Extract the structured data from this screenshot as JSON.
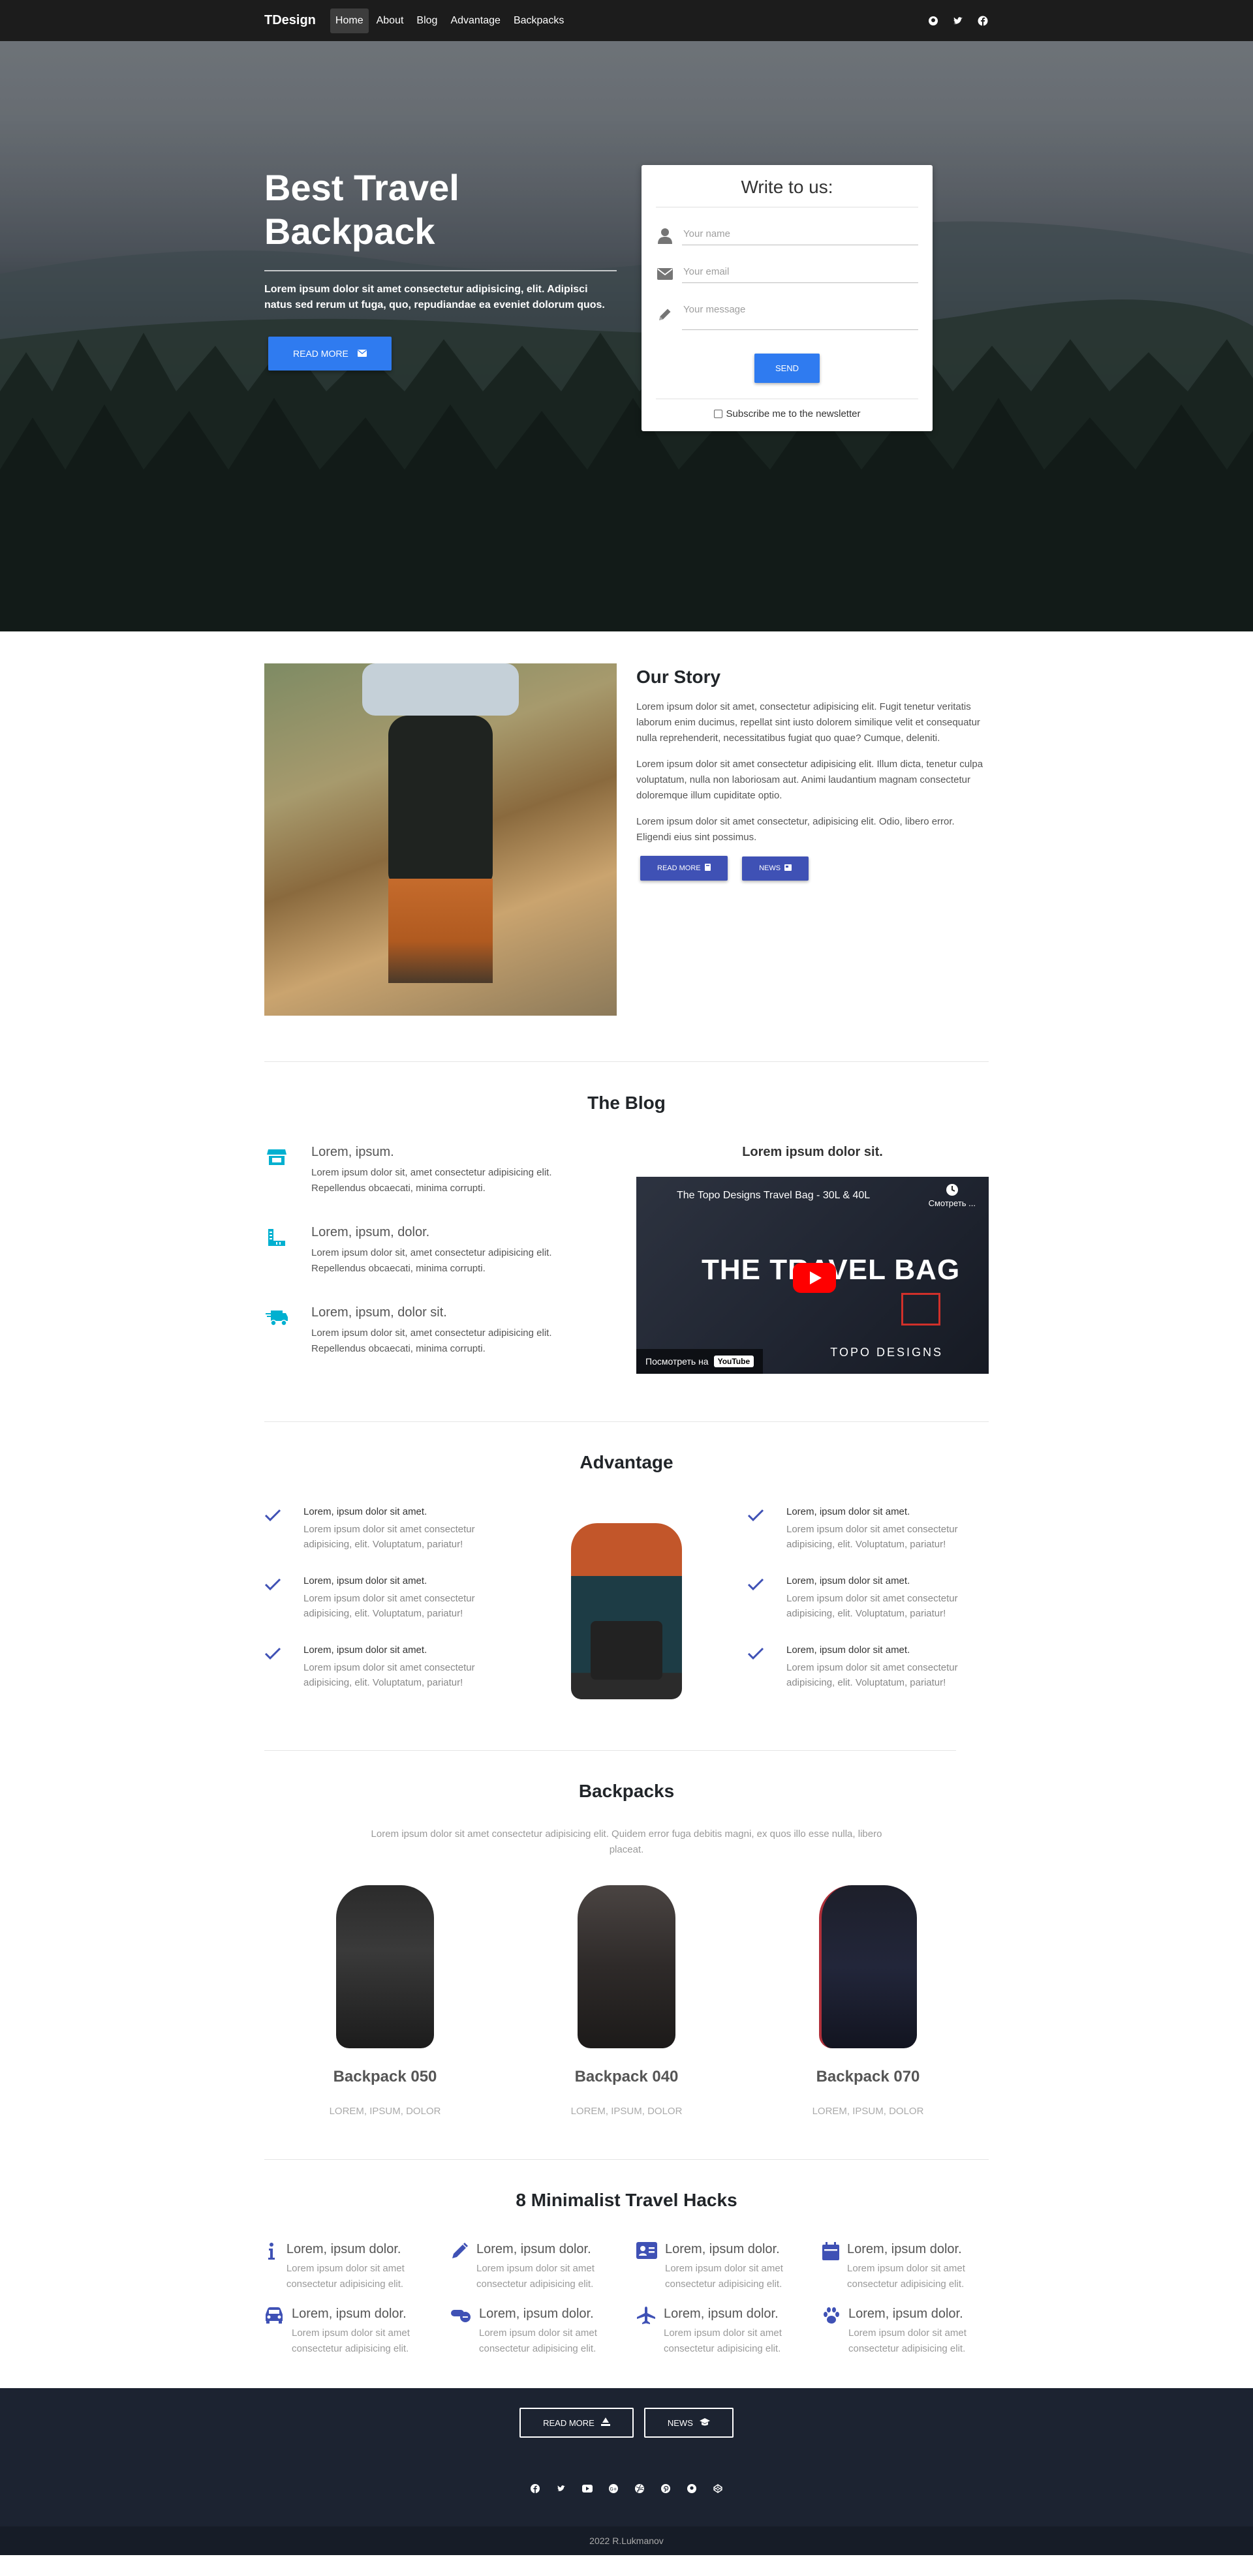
{
  "nav": {
    "brand": "TDesign",
    "links": [
      "Home",
      "About",
      "Blog",
      "Advantage",
      "Backpacks"
    ],
    "social_icons": [
      "github-icon",
      "twitter-icon",
      "facebook-icon"
    ]
  },
  "hero": {
    "title": "Best Travel Backpack",
    "subtitle": "Lorem ipsum dolor sit amet consectetur adipisicing, elit. Adipisci natus sed rerum ut fuga, quo, repudiandae ea eveniet dolorum quos.",
    "button": "Read more",
    "button_icon": "envelope-icon"
  },
  "contact": {
    "title": "Write to us:",
    "name_placeholder": "Your name",
    "email_placeholder": "Your email",
    "message_placeholder": "Your message",
    "send": "Send",
    "subscribe": "Subscribe me to the newsletter"
  },
  "story": {
    "title": "Our Story",
    "paragraphs": [
      "Lorem ipsum dolor sit amet, consectetur adipisicing elit. Fugit tenetur veritatis laborum enim ducimus, repellat sint iusto dolorem similique velit et consequatur nulla reprehenderit, necessitatibus fugiat quo quae? Cumque, deleniti.",
      "Lorem ipsum dolor sit amet consectetur adipisicing elit. Illum dicta, tenetur culpa voluptatum, nulla non laboriosam aut. Animi laudantium magnam consectetur doloremque illum cupiditate optio.",
      "Lorem ipsum dolor sit amet consectetur, adipisicing elit. Odio, libero error. Eligendi eius sint possimus."
    ],
    "buttons": [
      "Read more",
      "News"
    ]
  },
  "blog": {
    "title": "The Blog",
    "items": [
      {
        "icon": "store-icon",
        "title": "Lorem, ipsum.",
        "text": "Lorem ipsum dolor sit, amet consectetur adipisicing elit. Repellendus obcaecati, minima corrupti."
      },
      {
        "icon": "ruler-icon",
        "title": "Lorem, ipsum, dolor.",
        "text": "Lorem ipsum dolor sit, amet consectetur adipisicing elit. Repellendus obcaecati, minima corrupti."
      },
      {
        "icon": "truck-icon",
        "title": "Lorem, ipsum, dolor sit.",
        "text": "Lorem ipsum dolor sit, amet consectetur adipisicing elit. Repellendus obcaecati, minima corrupti."
      }
    ],
    "video_caption": "Lorem ipsum dolor sit.",
    "video": {
      "title": "The Topo Designs Travel Bag - 30L & 40L",
      "watch_later": "Смотреть ...",
      "big_text": "THE TRAVEL BAG",
      "watch_on": "Посмотреть на",
      "youtube": "YouTube",
      "brand": "TOPO DESIGNS"
    }
  },
  "advantage": {
    "title": "Advantage",
    "items": [
      {
        "title": "Lorem, ipsum dolor sit amet.",
        "text": "Lorem ipsum dolor sit amet consectetur adipisicing, elit. Voluptatum, pariatur!"
      },
      {
        "title": "Lorem, ipsum dolor sit amet.",
        "text": "Lorem ipsum dolor sit amet consectetur adipisicing, elit. Voluptatum, pariatur!"
      },
      {
        "title": "Lorem, ipsum dolor sit amet.",
        "text": "Lorem ipsum dolor sit amet consectetur adipisicing, elit. Voluptatum, pariatur!"
      },
      {
        "title": "Lorem, ipsum dolor sit amet.",
        "text": "Lorem ipsum dolor sit amet consectetur adipisicing, elit. Voluptatum, pariatur!"
      },
      {
        "title": "Lorem, ipsum dolor sit amet.",
        "text": "Lorem ipsum dolor sit amet consectetur adipisicing, elit. Voluptatum, pariatur!"
      },
      {
        "title": "Lorem, ipsum dolor sit amet.",
        "text": "Lorem ipsum dolor sit amet consectetur adipisicing, elit. Voluptatum, pariatur!"
      }
    ]
  },
  "backpacks": {
    "title": "Backpacks",
    "intro": "Lorem ipsum dolor sit amet consectetur adipisicing elit. Quidem error fuga debitis magni, ex quos illo esse nulla, libero placeat.",
    "items": [
      {
        "name": "Backpack 050",
        "tags": "Lorem, ipsum, dolor"
      },
      {
        "name": "Backpack 040",
        "tags": "Lorem, ipsum, dolor"
      },
      {
        "name": "Backpack 070",
        "tags": "Lorem, ipsum, dolor"
      }
    ]
  },
  "hacks": {
    "title": "8 Minimalist Travel Hacks",
    "items": [
      {
        "icon": "info-icon",
        "title": "Lorem, ipsum dolor.",
        "text": "Lorem ipsum dolor sit amet consectetur adipisicing elit."
      },
      {
        "icon": "pencil-icon",
        "title": "Lorem, ipsum dolor.",
        "text": "Lorem ipsum dolor sit amet consectetur adipisicing elit."
      },
      {
        "icon": "id-card-icon",
        "title": "Lorem, ipsum dolor.",
        "text": "Lorem ipsum dolor sit amet consectetur adipisicing elit."
      },
      {
        "icon": "calendar-icon",
        "title": "Lorem, ipsum dolor.",
        "text": "Lorem ipsum dolor sit amet consectetur adipisicing elit."
      },
      {
        "icon": "car-icon",
        "title": "Lorem, ipsum dolor.",
        "text": "Lorem ipsum dolor sit amet consectetur adipisicing elit."
      },
      {
        "icon": "pills-icon",
        "title": "Lorem, ipsum dolor.",
        "text": "Lorem ipsum dolor sit amet consectetur adipisicing elit."
      },
      {
        "icon": "plane-icon",
        "title": "Lorem, ipsum dolor.",
        "text": "Lorem ipsum dolor sit amet consectetur adipisicing elit."
      },
      {
        "icon": "paw-icon",
        "title": "Lorem, ipsum dolor.",
        "text": "Lorem ipsum dolor sit amet consectetur adipisicing elit."
      }
    ]
  },
  "footer": {
    "buttons": [
      "Read more",
      "News"
    ],
    "social_icons": [
      "facebook-icon",
      "twitter-icon",
      "youtube-icon",
      "google-plus-icon",
      "dribbble-icon",
      "pinterest-icon",
      "github-icon",
      "codepen-icon"
    ],
    "copyright": "2022 R.Lukmanov"
  },
  "colors": {
    "primary_blue": "#2f7bf0",
    "indigo": "#3f51b5",
    "cyan": "#00b0d0",
    "navbar": "#1c1c1c",
    "footer": "#1c2331"
  }
}
